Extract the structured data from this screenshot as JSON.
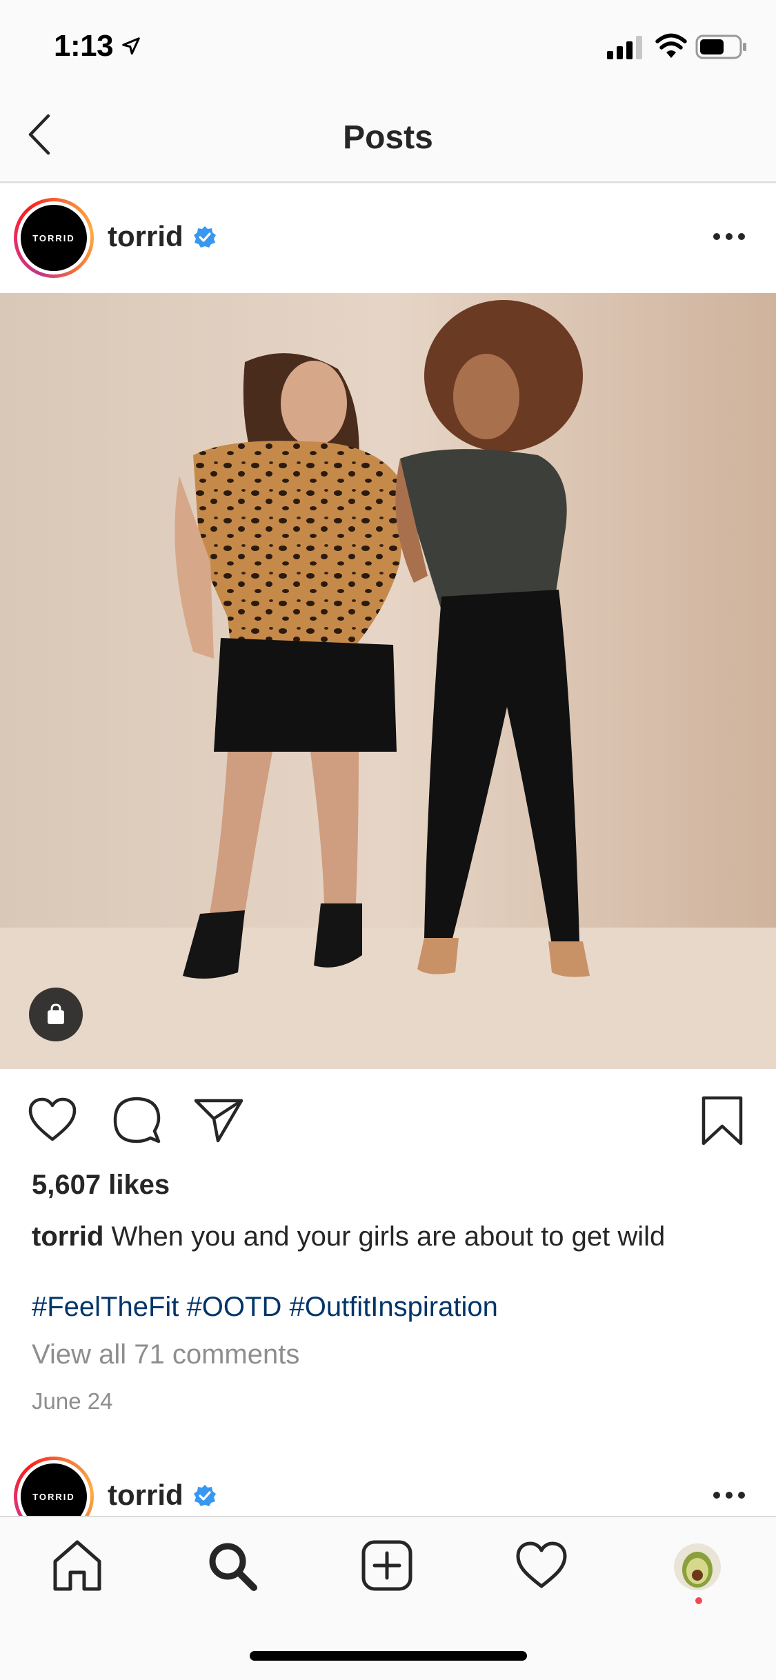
{
  "status_bar": {
    "time": "1:13"
  },
  "nav": {
    "title": "Posts"
  },
  "post": {
    "username": "torrid",
    "avatar_text": "TORRID",
    "likes": "5,607 likes",
    "caption_user": "torrid",
    "caption_text": " When you and your girls are about to get wild",
    "hashtags": [
      "#FeelTheFit",
      "#OOTD",
      "#OutfitInspiration"
    ],
    "view_comments": "View all 71 comments",
    "date": "June 24"
  },
  "next_post": {
    "username": "torrid",
    "avatar_text": "TORRID"
  },
  "colors": {
    "link": "#003569",
    "verified": "#3897f0",
    "muted": "#8e8e8e",
    "notification": "#ed4956"
  },
  "icons": {
    "status": [
      "location-arrow-icon",
      "cellular-signal-icon",
      "wifi-icon",
      "battery-icon"
    ],
    "actions": [
      "heart-icon",
      "comment-icon",
      "share-icon",
      "bookmark-icon"
    ],
    "tabs": [
      "home-icon",
      "search-icon",
      "add-post-icon",
      "activity-heart-icon",
      "profile-avatar-icon"
    ]
  }
}
